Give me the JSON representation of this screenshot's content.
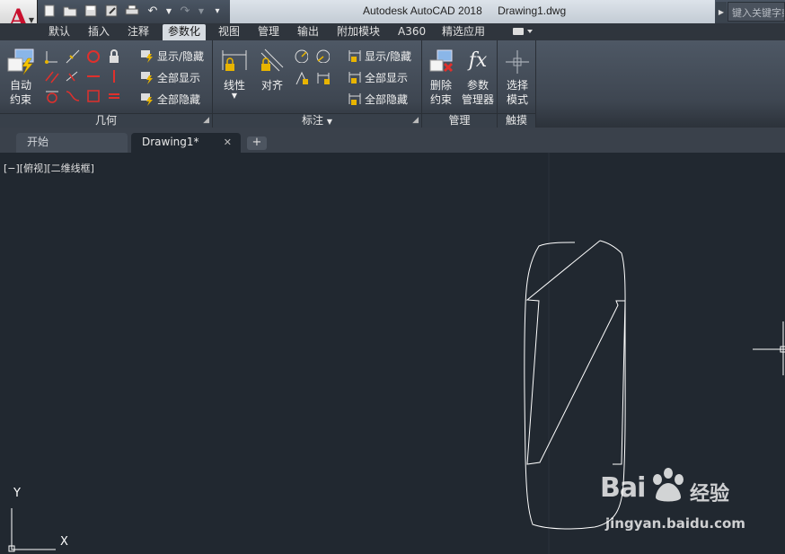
{
  "titlebar": {
    "app_title": "Autodesk AutoCAD 2018",
    "file_name": "Drawing1.dwg",
    "search_placeholder": "键入关键字或短语",
    "qat_icons": [
      "new-icon",
      "open-icon",
      "save-icon",
      "save-as-icon",
      "print-icon",
      "undo-icon",
      "redo-icon",
      "customize-icon"
    ]
  },
  "ribbon_tabs": [
    "默认",
    "插入",
    "注释",
    "参数化",
    "视图",
    "管理",
    "输出",
    "附加模块",
    "A360",
    "精选应用"
  ],
  "active_tab": "参数化",
  "panels": {
    "geometry": {
      "title": "几何",
      "auto_constrain_line1": "自动",
      "auto_constrain_line2": "约束",
      "show_hide": "显示/隐藏",
      "show_all": "全部显示",
      "hide_all": "全部隐藏"
    },
    "dimension": {
      "title": "标注",
      "linear": "线性",
      "aligned": "对齐",
      "show_hide": "显示/隐藏",
      "show_all": "全部显示",
      "hide_all": "全部隐藏"
    },
    "manage": {
      "title": "管理",
      "delete_line1": "删除",
      "delete_line2": "约束",
      "params_line1": "参数",
      "params_line2": "管理器",
      "fx": "fx"
    },
    "touch": {
      "title": "触摸",
      "select_line1": "选择",
      "select_line2": "模式"
    }
  },
  "file_tabs": {
    "start": "开始",
    "drawing": "Drawing1*",
    "add": "+"
  },
  "canvas": {
    "view_label": "[−][俯视][二维线框]",
    "ucs_x": "X",
    "ucs_y": "Y"
  },
  "watermark": {
    "brand_text": "Bai",
    "brand_suffix": "经验",
    "url": "jingyan.baidu.com"
  },
  "colors": {
    "canvas_bg": "#212830",
    "constraint_red": "#e0302c",
    "constraint_gold": "#e8b400",
    "drawing_line": "#ffffff"
  }
}
